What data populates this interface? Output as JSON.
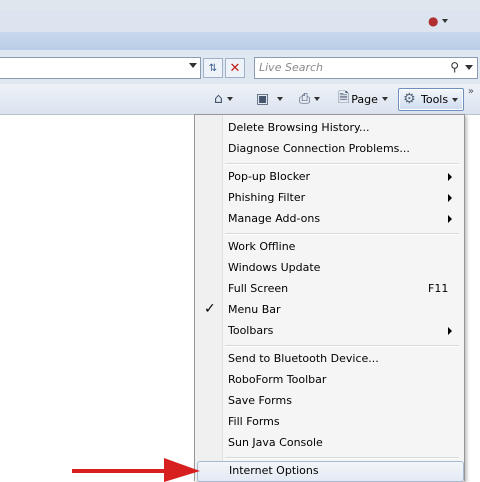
{
  "address_bar": {
    "value": ""
  },
  "search": {
    "placeholder": "Live Search"
  },
  "command_bar": {
    "page_label": "Page",
    "tools_label": "Tools",
    "overflow": "»"
  },
  "menu": {
    "items": [
      {
        "label": "Delete Browsing History..."
      },
      {
        "label": "Diagnose Connection Problems..."
      },
      {
        "label": "Pop-up Blocker",
        "submenu": true
      },
      {
        "label": "Phishing Filter",
        "submenu": true
      },
      {
        "label": "Manage Add-ons",
        "submenu": true
      },
      {
        "label": "Work Offline"
      },
      {
        "label": "Windows Update"
      },
      {
        "label": "Full Screen",
        "shortcut": "F11"
      },
      {
        "label": "Menu Bar",
        "checked": true,
        "check_mark": "✓"
      },
      {
        "label": "Toolbars",
        "submenu": true
      },
      {
        "label": "Send to Bluetooth Device..."
      },
      {
        "label": "RoboForm Toolbar"
      },
      {
        "label": "Save Forms"
      },
      {
        "label": "Fill Forms"
      },
      {
        "label": "Sun Java Console"
      },
      {
        "label": "Internet Options",
        "highlighted": true
      }
    ]
  },
  "colors": {
    "annotation_arrow": "#d81f1f",
    "highlight_border": "#a9b9d1"
  },
  "icons": [
    "home-icon",
    "feeds-icon",
    "print-icon",
    "page-icon",
    "gear-icon",
    "refresh-icon",
    "stop-icon",
    "search-icon",
    "user-icon"
  ]
}
